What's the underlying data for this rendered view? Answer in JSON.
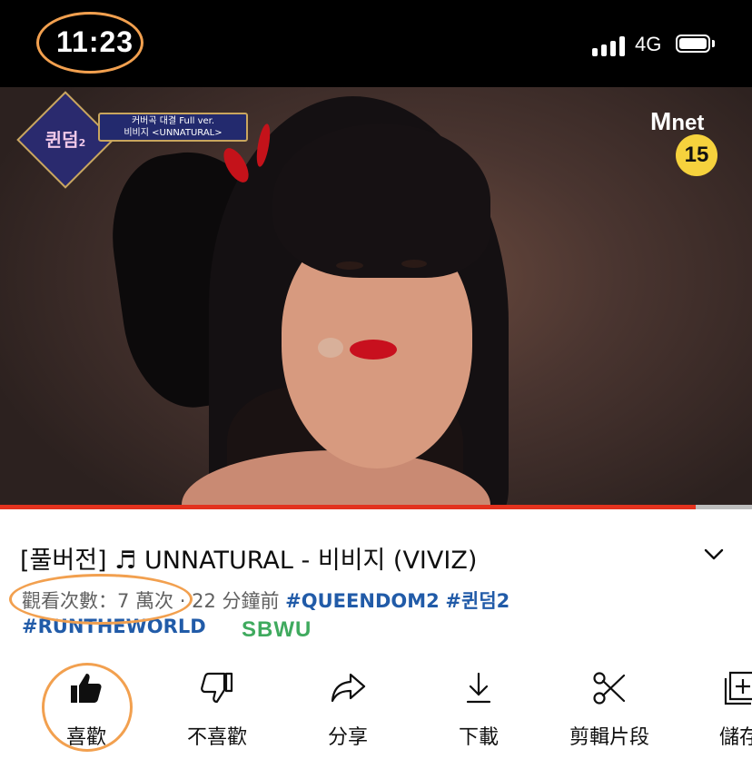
{
  "status_bar": {
    "time": "11:23",
    "network": "4G",
    "icons": [
      "cellular-signal-icon",
      "battery-icon"
    ]
  },
  "video": {
    "show_badge": "퀸덤",
    "show_badge_sub": "2",
    "banner_line1": "커버곡 대결 Full ver.",
    "banner_line2": "비비지 <UNNATURAL>",
    "channel_logo": "net",
    "channel_logo_m": "M",
    "age_rating": "15",
    "progress": 0.925,
    "progress_color": "#e3321e"
  },
  "details": {
    "title": "[풀버전] ♬ UNNATURAL - 비비지 (VIVIZ)",
    "views": "觀看次數：7 萬次",
    "separator": " · ",
    "time_ago": "22 分鐘前",
    "hashtag1": "#QUEENDOM2",
    "hashtag2": "#퀸덤2",
    "hashtag3": "#RUNTHEWORLD",
    "watermark": "SBWU"
  },
  "actions": [
    {
      "label": "喜歡",
      "icon": "thumbs-up-icon"
    },
    {
      "label": "不喜歡",
      "icon": "thumbs-down-icon"
    },
    {
      "label": "分享",
      "icon": "share-icon"
    },
    {
      "label": "下載",
      "icon": "download-icon"
    },
    {
      "label": "剪輯片段",
      "icon": "scissors-icon"
    },
    {
      "label": "儲存",
      "icon": "save-to-playlist-icon"
    }
  ],
  "colors": {
    "highlight": "#f2a04f",
    "link": "#215ba8",
    "watermark": "#3faa5e"
  }
}
